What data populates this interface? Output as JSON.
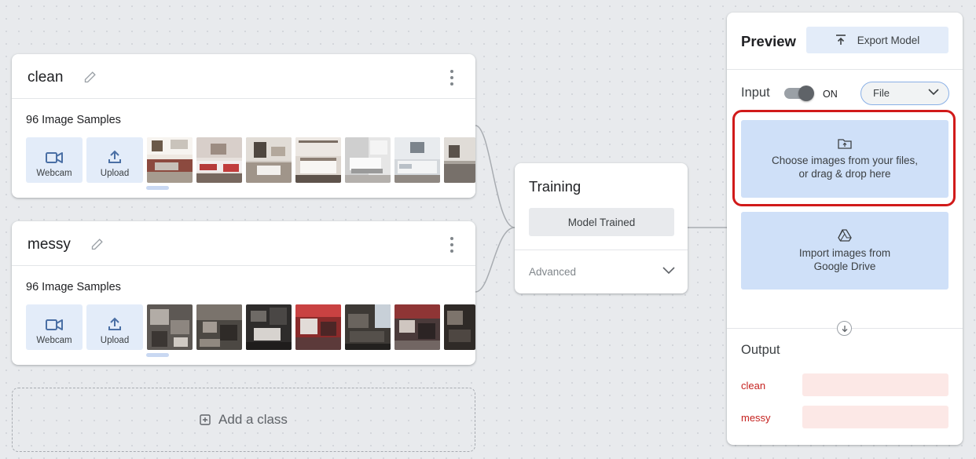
{
  "colors": {
    "accent_light_blue": "#cfe0f8",
    "button_blue": "#e3ecf9",
    "highlight_red": "#d11a1a",
    "output_red": "#c5221f",
    "output_bar": "#fce8e6"
  },
  "classes": [
    {
      "name": "clean",
      "samples_label": "96 Image Samples",
      "webcam_label": "Webcam",
      "upload_label": "Upload",
      "thumbnail_theme": "clean-bedroom-photos"
    },
    {
      "name": "messy",
      "samples_label": "96 Image Samples",
      "webcam_label": "Webcam",
      "upload_label": "Upload",
      "thumbnail_theme": "messy-room-photos"
    }
  ],
  "add_class": {
    "label": "Add a class"
  },
  "training": {
    "title": "Training",
    "status_button": "Model Trained",
    "advanced_label": "Advanced"
  },
  "preview": {
    "title": "Preview",
    "export_label": "Export Model",
    "input_label": "Input",
    "toggle_state": "ON",
    "source_select": "File",
    "drop_zone_line1": "Choose images from your files,",
    "drop_zone_line2": "or drag & drop here",
    "drive_line1": "Import images from",
    "drive_line2": "Google Drive",
    "output_label": "Output",
    "outputs": [
      {
        "label": "clean"
      },
      {
        "label": "messy"
      }
    ]
  },
  "icons": [
    "pencil-icon",
    "more-vert-icon",
    "webcam-icon",
    "upload-icon",
    "add-box-icon",
    "chevron-down-icon",
    "export-icon",
    "folder-upload-icon",
    "google-drive-icon",
    "arrow-down-circle-icon"
  ]
}
